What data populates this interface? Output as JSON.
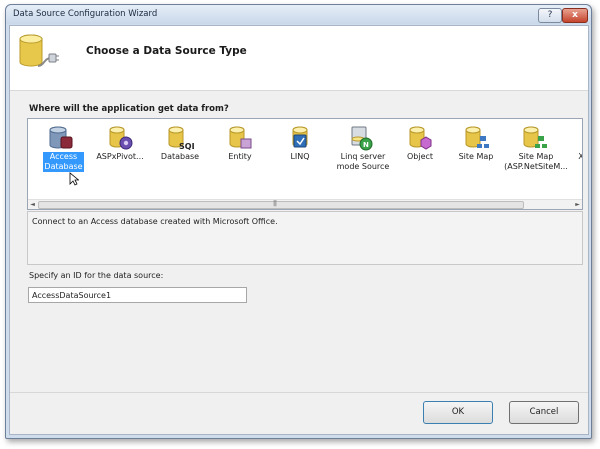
{
  "window": {
    "title": "Data Source Configuration Wizard",
    "help_label": "?",
    "close_label": "x"
  },
  "header": {
    "title": "Choose a Data Source Type"
  },
  "question": "Where will the application get data from?",
  "sources": [
    {
      "label": "Access Database",
      "icon": "access-database-icon",
      "selected": true
    },
    {
      "label": "ASPxPivot...",
      "icon": "pivot-gear-icon"
    },
    {
      "label": "Database",
      "icon": "sql-database-icon"
    },
    {
      "label": "Entity",
      "icon": "entity-icon"
    },
    {
      "label": "LINQ",
      "icon": "linq-icon"
    },
    {
      "label": "Linq server mode Source",
      "icon": "linq-server-icon"
    },
    {
      "label": "Object",
      "icon": "object-icon"
    },
    {
      "label": "Site Map",
      "icon": "sitemap-icon"
    },
    {
      "label": "Site Map (ASP.NetSiteM...",
      "icon": "sitemap-datasource-icon"
    },
    {
      "label": "X",
      "icon": "xml-icon"
    }
  ],
  "scroll": {
    "left": "◄",
    "right": "►",
    "grip": "|||"
  },
  "description": "Connect to an Access database created with Microsoft Office.",
  "id_label": "Specify an ID for the data source:",
  "id_value": "AccessDataSource1",
  "buttons": {
    "ok": "OK",
    "cancel": "Cancel"
  },
  "colors": {
    "selection": "#3399ff",
    "dialog": "#f0f0f0"
  }
}
